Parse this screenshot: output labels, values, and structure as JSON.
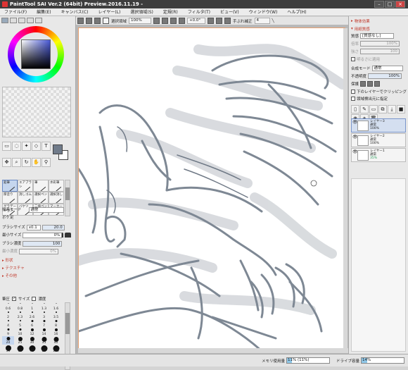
{
  "window": {
    "title": "PaintTool SAI Ver.2 (64bit) Preview.2016.11.19 -"
  },
  "menu": [
    "ファイル(F)",
    "編集(E)",
    "キャンバス(C)",
    "レイヤー(L)",
    "選択領域(S)",
    "定規(R)",
    "フィルタ(T)",
    "ビュー(V)",
    "ウィンドウ(W)",
    "ヘルプ(H)"
  ],
  "toolbar": {
    "selection_label": "選択領域",
    "zoom": "100%",
    "angle": "+0.0°",
    "stabilizer_label": "手ぶれ補正",
    "stabilizer_value": "4"
  },
  "colors": {
    "current": "#707b8a",
    "secondary": "#ffffff",
    "accent": "#c0392b"
  },
  "brushes": [
    {
      "label": "鉛筆",
      "sel": true
    },
    {
      "label": "エアブラシ"
    },
    {
      "label": "筆"
    },
    {
      "label": "水彩筆"
    },
    {
      "label": "厚塗り"
    },
    {
      "label": "消しゴム"
    },
    {
      "label": "選択ペン"
    },
    {
      "label": "選択消し"
    },
    {
      "label": "グラデーション"
    },
    {
      "label": "バケツ"
    },
    {
      "label": "二値ペン"
    },
    {
      "label": "マーカー"
    }
  ],
  "brush_props": {
    "mode_label": "描画モード",
    "mode_value": "通常",
    "edge_label": "ボケ足",
    "size_label": "ブラシサイズ",
    "size_mult": "x0.1",
    "size_value": "20.0",
    "min_size_label": "最小サイズ",
    "min_size_value": "0%",
    "density_label": "ブラシ濃度",
    "density_value": "100",
    "min_density_label": "最小濃度",
    "min_density_value": "0%"
  },
  "sections": {
    "shape": "形状",
    "texture": "テクスチャ",
    "other": "その他"
  },
  "pressure": {
    "label": "筆圧",
    "size": "サイズ",
    "density": "濃度"
  },
  "brush_sizes": [
    "0.6",
    "0.8",
    "1",
    "1.3",
    "1.6",
    "2",
    "2.3",
    "2.6",
    "3",
    "3.5",
    "4",
    "5",
    "6",
    "7",
    "8",
    "9",
    "10",
    "12",
    "14",
    "16",
    "20",
    "25",
    "30",
    "35",
    "40",
    "50",
    "60",
    "70",
    "80",
    "100"
  ],
  "right": {
    "paper_effect": "物体効果",
    "canvas_paper": "用紙質感",
    "texture_label": "質感",
    "texture_value": "[質感なし]",
    "scale_label": "倍率",
    "scale_value": "100%",
    "strength_label": "強さ",
    "strength_value": "100",
    "brightness_option": "明るさに適用",
    "blend_label": "合成モード",
    "blend_value": "通常",
    "opacity_label": "不透明度",
    "opacity_value": "100%",
    "protect_label": "保護",
    "clip_label": "下のレイヤーでクリッピング",
    "selection_source_label": "領域検出元に指定"
  },
  "layers": [
    {
      "name": "レイヤー3",
      "mode": "通常",
      "opacity": "100%",
      "sel": true
    },
    {
      "name": "レイヤー2",
      "mode": "通常",
      "opacity": "100%"
    },
    {
      "name": "レイヤー1",
      "mode": "通常",
      "opacity": "35%"
    }
  ],
  "status": {
    "memory_label": "メモリ使用量",
    "memory_value": "11% (11%)",
    "memory_fill": 0.11,
    "drive_label": "ドライブ容量",
    "drive_value": "14%",
    "drive_fill": 0.14
  }
}
